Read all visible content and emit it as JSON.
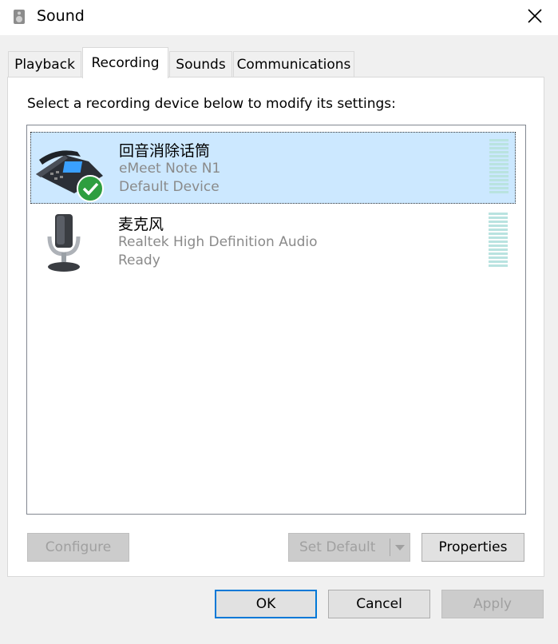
{
  "window": {
    "title": "Sound",
    "close_label": "✕"
  },
  "tabs": [
    {
      "label": "Playback"
    },
    {
      "label": "Recording"
    },
    {
      "label": "Sounds"
    },
    {
      "label": "Communications"
    }
  ],
  "active_tab": "Recording",
  "instruction": "Select a recording device below to modify its settings:",
  "devices": [
    {
      "name": "回音消除话筒",
      "driver": "eMeet Note N1",
      "status": "Default Device",
      "icon": "speakerphone-icon",
      "badge": "default-check-icon",
      "selected": true,
      "level_fraction": 0
    },
    {
      "name": "麦克风",
      "driver": "Realtek High Definition Audio",
      "status": "Ready",
      "icon": "microphone-icon",
      "selected": false,
      "level_fraction": 0
    }
  ],
  "buttons": {
    "configure": "Configure",
    "set_default": "Set Default",
    "properties": "Properties",
    "ok": "OK",
    "cancel": "Cancel",
    "apply": "Apply"
  },
  "colors": {
    "selection": "#cce8ff",
    "check_badge": "#2e9e3f",
    "meter": "#b9e3e0",
    "accent": "#0078d7"
  }
}
